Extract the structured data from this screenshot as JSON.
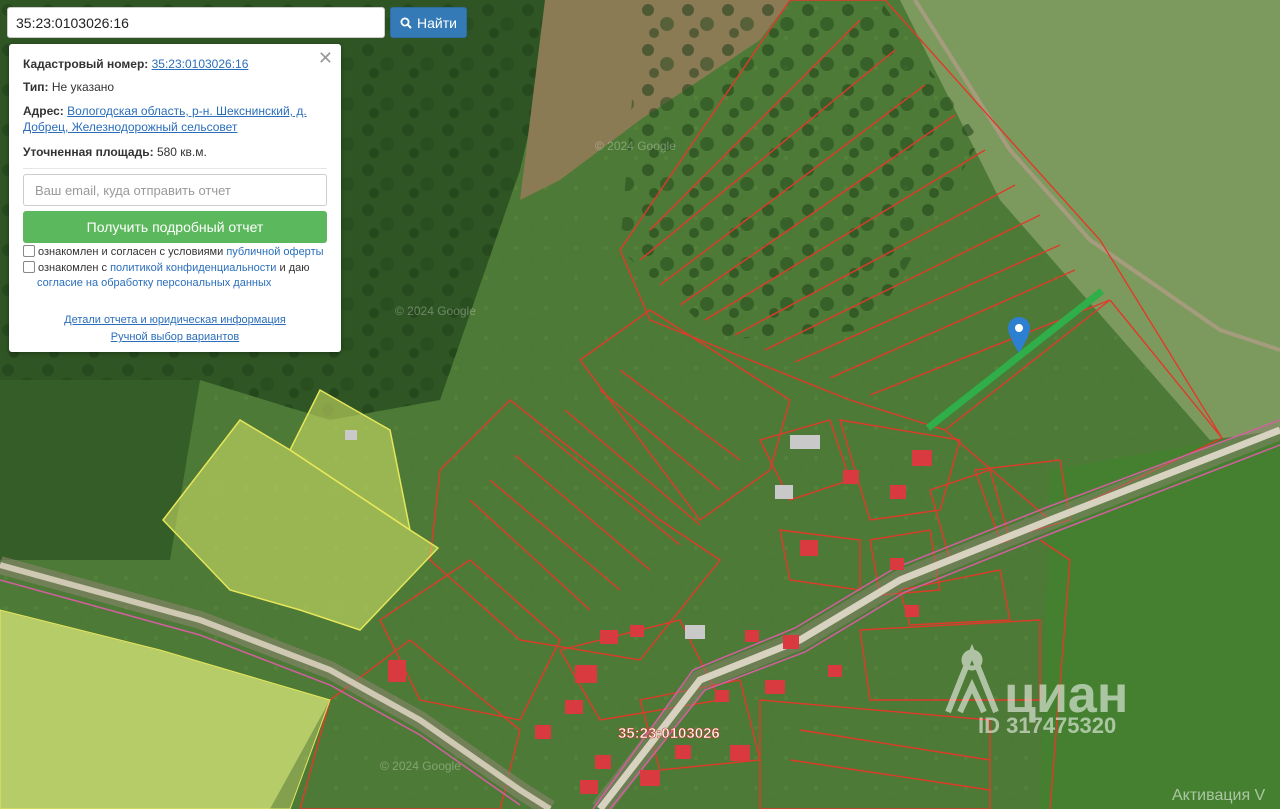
{
  "search": {
    "value": "35:23:0103026:16",
    "button_label": "Найти"
  },
  "panel": {
    "cadastral_label": "Кадастровый номер:",
    "cadastral_value": "35:23:0103026:16",
    "type_label": "Тип:",
    "type_value": "Не указано",
    "address_label": "Адрес:",
    "address_line1": "Вологодская область, р-н. Шекснинский, д.",
    "address_line2": "Добрец, Железнодорожный сельсовет",
    "area_label": "Уточненная площадь:",
    "area_value": "580 кв.м.",
    "email_placeholder": "Ваш email, куда отправить отчет",
    "report_button": "Получить подробный отчет",
    "consent1_text": "ознакомлен и согласен с условиями",
    "consent1_link": "публичной оферты",
    "consent2_text_a": "ознакомлен с",
    "consent2_link_a": "политикой конфиденциальности",
    "consent2_text_b": "и даю",
    "consent2_link_b": "согласие на обработку персональных данных",
    "link_details": "Детали отчета и юридическая информация",
    "link_manual": "Ручной выбор вариантов"
  },
  "map": {
    "parcel_label": "35:23:0103026",
    "watermark_text": "© 2024 Google",
    "cian_logo": "циан",
    "cian_id": "ID 317475320",
    "activation_text": "Активация V"
  },
  "colors": {
    "accent_blue": "#337ab7",
    "accent_green": "#5cb85c",
    "parcel_red": "#e03a2a",
    "selection_green": "#2fae4a"
  },
  "icons": {
    "search": "search-icon",
    "close": "close-icon",
    "marker": "map-marker-icon"
  }
}
